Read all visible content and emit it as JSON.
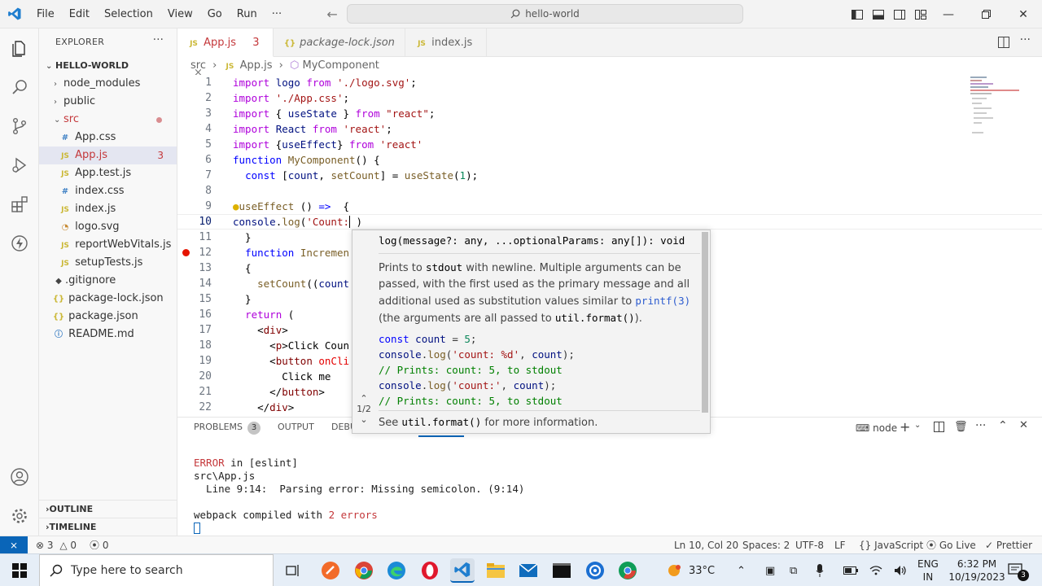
{
  "titlebar": {
    "menus": [
      "File",
      "Edit",
      "Selection",
      "View",
      "Go",
      "Run",
      "···"
    ],
    "search": "hello-world"
  },
  "sidebar": {
    "header": "EXPLORER",
    "more": "···",
    "root": "HELLO-WORLD",
    "items": [
      {
        "label": "node_modules",
        "kind": "folder"
      },
      {
        "label": "public",
        "kind": "folder"
      },
      {
        "label": "src",
        "kind": "folder-open"
      },
      {
        "label": "App.css",
        "kind": "css"
      },
      {
        "label": "App.js",
        "kind": "js",
        "errors": "3"
      },
      {
        "label": "App.test.js",
        "kind": "js"
      },
      {
        "label": "index.css",
        "kind": "css"
      },
      {
        "label": "index.js",
        "kind": "js"
      },
      {
        "label": "logo.svg",
        "kind": "svg"
      },
      {
        "label": "reportWebVitals.js",
        "kind": "js"
      },
      {
        "label": "setupTests.js",
        "kind": "js"
      },
      {
        "label": ".gitignore",
        "kind": "git"
      },
      {
        "label": "package-lock.json",
        "kind": "json"
      },
      {
        "label": "package.json",
        "kind": "json"
      },
      {
        "label": "README.md",
        "kind": "info"
      }
    ],
    "outline": "OUTLINE",
    "timeline": "TIMELINE"
  },
  "tabs": [
    {
      "label": "App.js",
      "badge": "3",
      "icon": "JS"
    },
    {
      "label": "package-lock.json",
      "icon": "{}"
    },
    {
      "label": "index.js",
      "icon": "JS"
    }
  ],
  "breadcrumb": [
    "src",
    "App.js",
    "MyComponent"
  ],
  "editor": {
    "line_numbers": [
      "1",
      "2",
      "3",
      "4",
      "5",
      "6",
      "7",
      "8",
      "9",
      "10",
      "11",
      "12",
      "13",
      "14",
      "15",
      "16",
      "17",
      "18",
      "19",
      "20",
      "21",
      "22"
    ]
  },
  "hover": {
    "signature": "log(message?: any, ...optionalParams: any[]): void",
    "nav": "1/2",
    "desc_1": "Prints to ",
    "desc_code_1": "stdout",
    "desc_2": " with newline. Multiple arguments can be passed, with the first used as the primary message and all additional used as substitution values similar to ",
    "desc_code_2": "printf(3)",
    "desc_3": "(the arguments are all passed to ",
    "desc_code_3": "util.format()",
    "desc_4": ").",
    "see_1": "See ",
    "see_code": "util.format()",
    "see_2": " for more information."
  },
  "panel": {
    "tabs": [
      {
        "label": "PROBLEMS",
        "badge": "3"
      },
      {
        "label": "OUTPUT"
      },
      {
        "label": "DEBU"
      }
    ],
    "terminal_name": "node",
    "output": {
      "error_word": "ERROR",
      "error_rest": " in [eslint]",
      "file": "src\\App.js",
      "detail": "  Line 9:14:  Parsing error: Missing semicolon. (9:14)",
      "compiled_1": "webpack compiled with ",
      "compiled_2": "2 errors"
    }
  },
  "statusbar": {
    "errors": "3",
    "warnings": "0",
    "ports": "0",
    "position": "Ln 10, Col 20",
    "spaces": "Spaces: 2",
    "encoding": "UTF-8",
    "eol": "LF",
    "language": "JavaScript",
    "golive": "Go Live",
    "prettier": "Prettier"
  },
  "taskbar": {
    "search_placeholder": "Type here to search",
    "temperature": "33°C",
    "lang_1": "ENG",
    "lang_2": "IN",
    "time": "6:32 PM",
    "date": "10/19/2023",
    "notifications": "3"
  },
  "colors": {
    "accent": "#0a65b8",
    "error": "#c4383b",
    "breakpoint": "#e51400"
  }
}
